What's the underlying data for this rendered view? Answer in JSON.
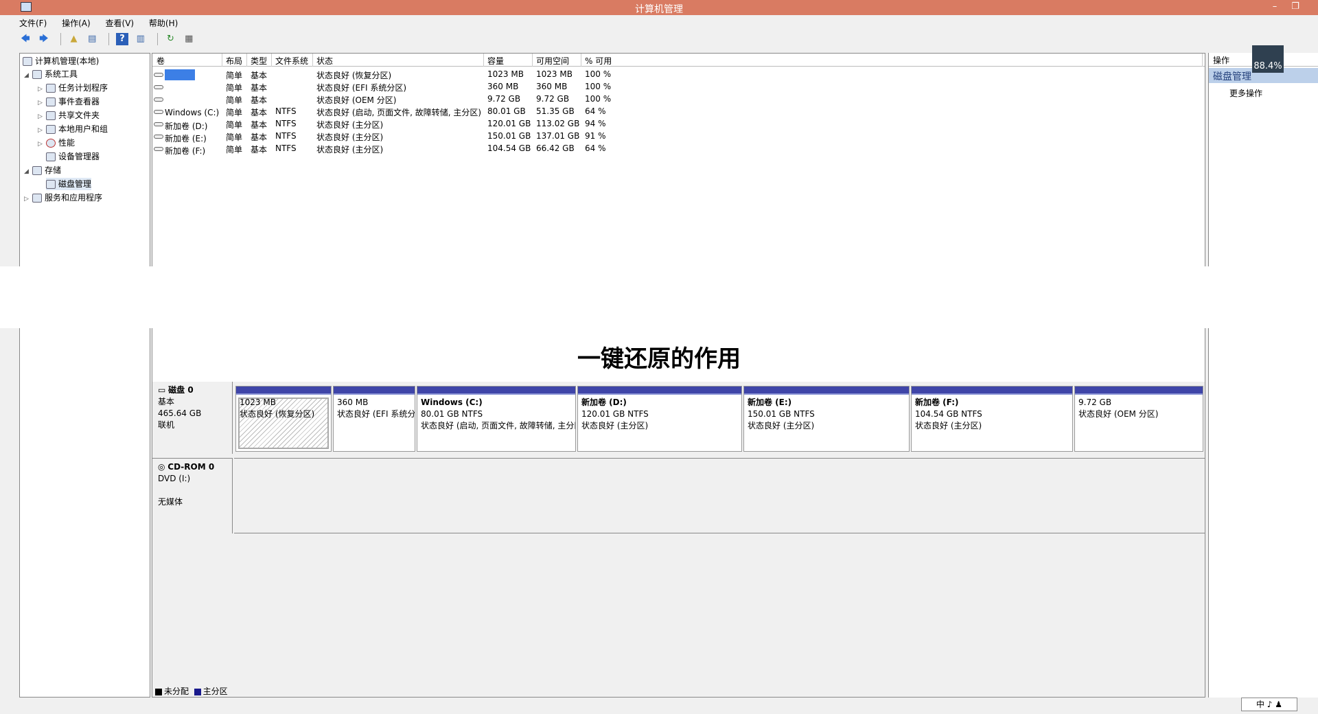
{
  "window": {
    "title": "计算机管理",
    "min_glyph": "–",
    "restore_glyph": "❐"
  },
  "menu": [
    "文件(F)",
    "操作(A)",
    "查看(V)",
    "帮助(H)"
  ],
  "toolbar": {
    "back": "🡄",
    "forward": "🡆",
    "up": "▲",
    "show_tree": "▤",
    "help": "?",
    "view": "▥",
    "refresh": "↻",
    "export": "▦"
  },
  "tree": {
    "root": "计算机管理(本地)",
    "system_tools": "系统工具",
    "task_scheduler": "任务计划程序",
    "event_viewer": "事件查看器",
    "shared_folders": "共享文件夹",
    "local_users": "本地用户和组",
    "performance": "性能",
    "device_manager": "设备管理器",
    "storage": "存储",
    "disk_management": "磁盘管理",
    "services_apps": "服务和应用程序"
  },
  "volume_table": {
    "headers": [
      "卷",
      "布局",
      "类型",
      "文件系统",
      "状态",
      "容量",
      "可用空间",
      "% 可用"
    ],
    "rows": [
      {
        "vol": "",
        "layout": "简单",
        "type": "基本",
        "fs": "",
        "status": "状态良好 (恢复分区)",
        "cap": "1023 MB",
        "free": "1023 MB",
        "pct": "100 %"
      },
      {
        "vol": "",
        "layout": "简单",
        "type": "基本",
        "fs": "",
        "status": "状态良好 (EFI 系统分区)",
        "cap": "360 MB",
        "free": "360 MB",
        "pct": "100 %"
      },
      {
        "vol": "",
        "layout": "简单",
        "type": "基本",
        "fs": "",
        "status": "状态良好 (OEM 分区)",
        "cap": "9.72 GB",
        "free": "9.72 GB",
        "pct": "100 %"
      },
      {
        "vol": "Windows (C:)",
        "layout": "简单",
        "type": "基本",
        "fs": "NTFS",
        "status": "状态良好 (启动, 页面文件, 故障转储, 主分区)",
        "cap": "80.01 GB",
        "free": "51.35 GB",
        "pct": "64 %"
      },
      {
        "vol": "新加卷 (D:)",
        "layout": "简单",
        "type": "基本",
        "fs": "NTFS",
        "status": "状态良好 (主分区)",
        "cap": "120.01 GB",
        "free": "113.02 GB",
        "pct": "94 %"
      },
      {
        "vol": "新加卷 (E:)",
        "layout": "简单",
        "type": "基本",
        "fs": "NTFS",
        "status": "状态良好 (主分区)",
        "cap": "150.01 GB",
        "free": "137.01 GB",
        "pct": "91 %"
      },
      {
        "vol": "新加卷 (F:)",
        "layout": "简单",
        "type": "基本",
        "fs": "NTFS",
        "status": "状态良好 (主分区)",
        "cap": "104.54 GB",
        "free": "66.42 GB",
        "pct": "64 %"
      }
    ]
  },
  "overlay_text": "一键还原的作用",
  "disk0": {
    "name": "磁盘 0",
    "type": "基本",
    "size": "465.64 GB",
    "state": "联机",
    "partitions": [
      {
        "title": "",
        "line1": "1023 MB",
        "line2": "状态良好 (恢复分区)"
      },
      {
        "title": "",
        "line1": "360 MB",
        "line2": "状态良好 (EFI 系统分区)"
      },
      {
        "title": "Windows  (C:)",
        "line1": "80.01 GB NTFS",
        "line2": "状态良好 (启动, 页面文件, 故障转储, 主分区)"
      },
      {
        "title": "新加卷  (D:)",
        "line1": "120.01 GB NTFS",
        "line2": "状态良好 (主分区)"
      },
      {
        "title": "新加卷  (E:)",
        "line1": "150.01 GB NTFS",
        "line2": "状态良好 (主分区)"
      },
      {
        "title": "新加卷  (F:)",
        "line1": "104.54 GB NTFS",
        "line2": "状态良好 (主分区)"
      },
      {
        "title": "",
        "line1": "9.72 GB",
        "line2": "状态良好 (OEM 分区)"
      }
    ]
  },
  "cdrom": {
    "name": "CD-ROM 0",
    "drive": "DVD (I:)",
    "media": "无媒体"
  },
  "legend": {
    "unallocated": "未分配",
    "primary": "主分区",
    "unallocated_color": "#000000",
    "primary_color": "#1a1a8c"
  },
  "actions": {
    "header": "操作",
    "section": "磁盘管理",
    "more": "更多操作"
  },
  "badge": "88.4%",
  "ime": "中 ♪ ♟"
}
